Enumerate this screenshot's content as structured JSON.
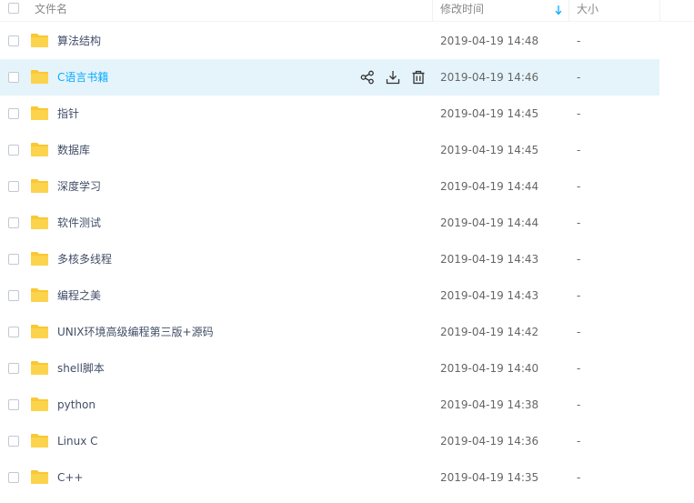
{
  "header": {
    "name_col": "文件名",
    "time_col": "修改时间",
    "size_col": "大小"
  },
  "files": [
    {
      "name": "算法结构",
      "time": "2019-04-19 14:48",
      "size": "-"
    },
    {
      "name": "C语言书籍",
      "time": "2019-04-19 14:46",
      "size": "-"
    },
    {
      "name": "指针",
      "time": "2019-04-19 14:45",
      "size": "-"
    },
    {
      "name": "数据库",
      "time": "2019-04-19 14:45",
      "size": "-"
    },
    {
      "name": "深度学习",
      "time": "2019-04-19 14:44",
      "size": "-"
    },
    {
      "name": "软件测试",
      "time": "2019-04-19 14:44",
      "size": "-"
    },
    {
      "name": "多核多线程",
      "time": "2019-04-19 14:43",
      "size": "-"
    },
    {
      "name": "编程之美",
      "time": "2019-04-19 14:43",
      "size": "-"
    },
    {
      "name": "UNIX环境高级编程第三版+源码",
      "time": "2019-04-19 14:42",
      "size": "-"
    },
    {
      "name": "shell脚本",
      "time": "2019-04-19 14:40",
      "size": "-"
    },
    {
      "name": "python",
      "time": "2019-04-19 14:38",
      "size": "-"
    },
    {
      "name": "Linux C",
      "time": "2019-04-19 14:36",
      "size": "-"
    },
    {
      "name": "C++",
      "time": "2019-04-19 14:35",
      "size": "-"
    }
  ],
  "hovered_row": "C语言书籍",
  "row_actions": [
    "share-icon",
    "download-icon",
    "delete-icon"
  ],
  "colors": {
    "folder": "#f9c833",
    "hover_bg": "#e5f4fb",
    "accent": "#09aaff",
    "sort_arrow": "#09aaff"
  }
}
